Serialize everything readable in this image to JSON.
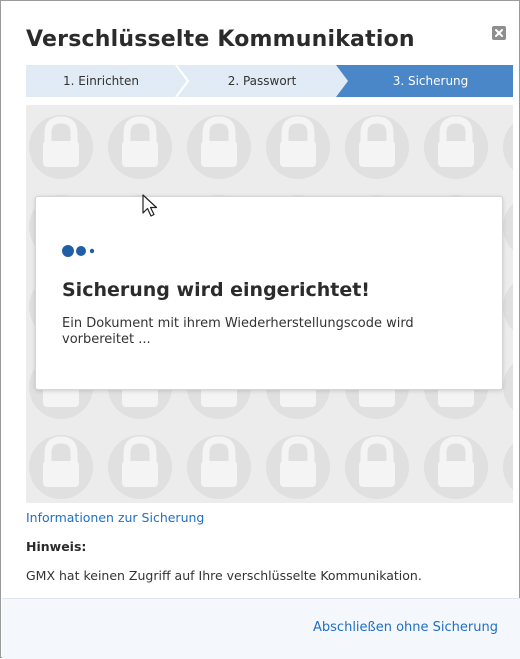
{
  "dialog": {
    "title": "Verschlüsselte Kommunikation"
  },
  "steps": [
    {
      "label": "1. Einrichten",
      "state": "done"
    },
    {
      "label": "2. Passwort",
      "state": "done"
    },
    {
      "label": "3. Sicherung",
      "state": "active"
    }
  ],
  "card": {
    "title": "Sicherung wird eingerichtet!",
    "text": "Ein Dokument mit ihrem Wiederherstellungscode wird vorbereitet ..."
  },
  "info_link": "Informationen zur Sicherung",
  "note": {
    "label": "Hinweis:",
    "text": "GMX hat keinen Zugriff auf Ihre verschlüsselte Kommunikation."
  },
  "footer": {
    "finish_label": "Abschließen ohne Sicherung"
  },
  "colors": {
    "step_inactive": "#e1ebf6",
    "step_active": "#4a87c8",
    "link": "#1f6fc5",
    "pattern_bg": "#ececec",
    "pattern_lock": "#e2e2e2",
    "dot_dark": "#1f5fa8"
  },
  "icons": {
    "close": "close-box-icon",
    "loader": "loading-dots-icon",
    "pattern": "padlock-pattern"
  }
}
